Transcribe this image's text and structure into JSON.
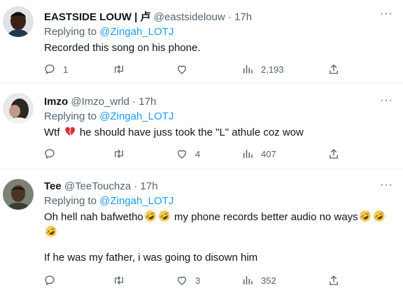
{
  "tweets": [
    {
      "display_name": "EASTSIDE LOUW | 卢",
      "handle": "@eastsidelouw",
      "separator": "·",
      "time": "17h",
      "replying_label": "Replying to",
      "replying_to": "@Zingah_LOTJ",
      "text": "Recorded this song on his phone.",
      "replies": "1",
      "retweets": "",
      "likes": "",
      "views": "2,193"
    },
    {
      "display_name": "Imzo",
      "handle": "@Imzo_wrld",
      "separator": "·",
      "time": "17h",
      "replying_label": "Replying to",
      "replying_to": "@Zingah_LOTJ",
      "text_before": "Wtf",
      "text_after": "he should have juss took the \"L\" athule coz wow",
      "replies": "",
      "retweets": "",
      "likes": "4",
      "views": "407"
    },
    {
      "display_name": "Tee",
      "handle": "@TeeTouchza",
      "separator": "·",
      "time": "17h",
      "replying_label": "Replying to",
      "replying_to": "@Zingah_LOTJ",
      "text_part1": "Oh hell nah bafwetho",
      "text_part2": "my phone records better audio no ways",
      "text_line2": "If he was my father, i was going to disown him",
      "replies": "",
      "retweets": "",
      "likes": "3",
      "views": "352"
    }
  ],
  "more_glyph": "···",
  "icons": [
    "reply-icon",
    "retweet-icon",
    "like-icon",
    "views-icon",
    "share-icon",
    "more-icon",
    "broken-heart-emoji",
    "rofl-emoji"
  ],
  "colors": {
    "link": "#1d9bf0",
    "muted": "#536471",
    "text": "#0f1419",
    "divider": "#eff3f4",
    "broken_heart": "#dd2e44",
    "emoji_face": "#ffcc4d"
  }
}
